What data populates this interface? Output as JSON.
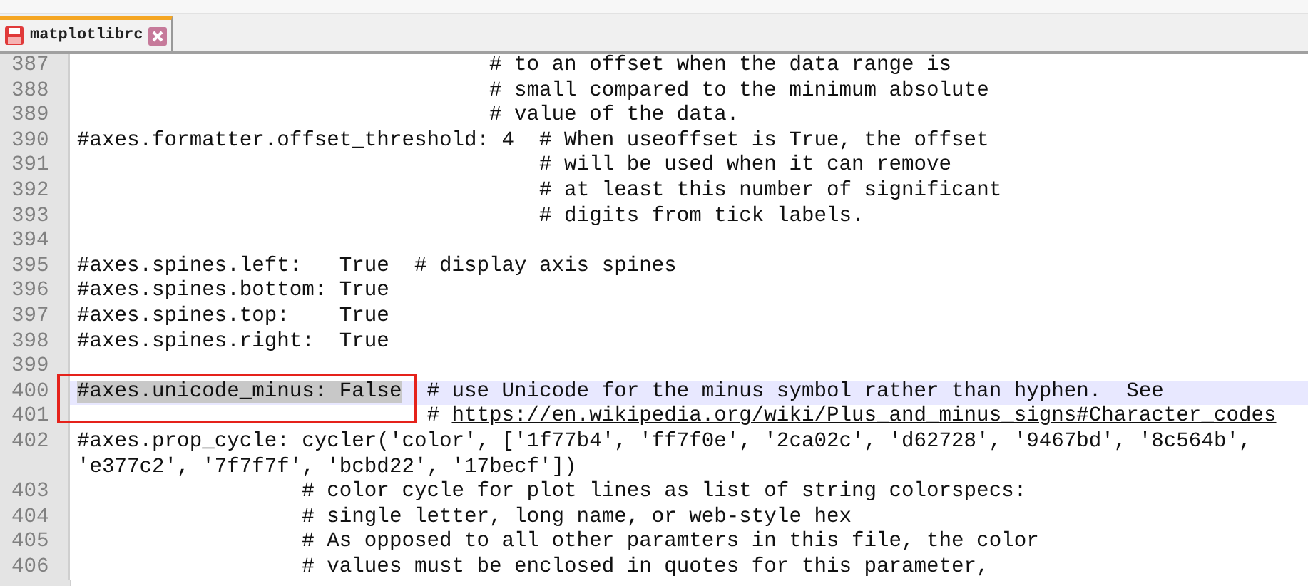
{
  "tab": {
    "title": "matplotlibrc",
    "selected": true
  },
  "lines": [
    {
      "number": "387",
      "current": false,
      "segments": [
        {
          "kind": "code",
          "text": "                                 # to an offset when the data range is"
        }
      ]
    },
    {
      "number": "388",
      "current": false,
      "segments": [
        {
          "kind": "code",
          "text": "                                 # small compared to the minimum absolute"
        }
      ]
    },
    {
      "number": "389",
      "current": false,
      "segments": [
        {
          "kind": "code",
          "text": "                                 # value of the data."
        }
      ]
    },
    {
      "number": "390",
      "current": false,
      "segments": [
        {
          "kind": "code",
          "text": "#axes.formatter.offset_threshold: 4  # When useoffset is True, the offset"
        }
      ]
    },
    {
      "number": "391",
      "current": false,
      "segments": [
        {
          "kind": "code",
          "text": "                                     # will be used when it can remove"
        }
      ]
    },
    {
      "number": "392",
      "current": false,
      "segments": [
        {
          "kind": "code",
          "text": "                                     # at least this number of significant"
        }
      ]
    },
    {
      "number": "393",
      "current": false,
      "segments": [
        {
          "kind": "code",
          "text": "                                     # digits from tick labels."
        }
      ]
    },
    {
      "number": "394",
      "current": false
    },
    {
      "number": "395",
      "current": false,
      "segments": [
        {
          "kind": "code",
          "text": "#axes.spines.left:   True  # display axis spines"
        }
      ]
    },
    {
      "number": "396",
      "current": false,
      "segments": [
        {
          "kind": "code",
          "text": "#axes.spines.bottom: True"
        }
      ]
    },
    {
      "number": "397",
      "current": false,
      "segments": [
        {
          "kind": "code",
          "text": "#axes.spines.top:    True"
        }
      ]
    },
    {
      "number": "398",
      "current": false,
      "segments": [
        {
          "kind": "code",
          "text": "#axes.spines.right:  True"
        }
      ]
    },
    {
      "number": "399",
      "current": false
    },
    {
      "number": "400",
      "current": true,
      "segments": [
        {
          "kind": "selection",
          "text": "#axes.unicode_minus: False"
        },
        {
          "kind": "code",
          "text": "  # use Unicode for the minus symbol rather than hyphen.  See"
        }
      ]
    },
    {
      "number": "401",
      "current": false,
      "segments": [
        {
          "kind": "code",
          "text": "                            # "
        },
        {
          "kind": "link",
          "text": "https://en.wikipedia.org/wiki/Plus_and_minus_signs#Character_codes"
        }
      ]
    },
    {
      "number": "402",
      "current": false,
      "segments": [
        {
          "kind": "code",
          "text": "#axes.prop_cycle: cycler('color', ['1f77b4', 'ff7f0e', '2ca02c', 'd62728', '9467bd', '8c564b', 'e377c2', '7f7f7f', 'bcbd22', '17becf'])"
        }
      ]
    },
    {
      "number": "403",
      "current": false,
      "segments": [
        {
          "kind": "code",
          "text": "                  # color cycle for plot lines as list of string colorspecs:"
        }
      ]
    },
    {
      "number": "404",
      "current": false,
      "segments": [
        {
          "kind": "code",
          "text": "                  # single letter, long name, or web-style hex"
        }
      ]
    },
    {
      "number": "405",
      "current": false,
      "segments": [
        {
          "kind": "code",
          "text": "                  # As opposed to all other paramters in this file, the color"
        }
      ]
    },
    {
      "number": "406",
      "current": false,
      "segments": [
        {
          "kind": "code",
          "text": "                  # values must be enclosed in quotes for this parameter,"
        }
      ]
    }
  ]
}
